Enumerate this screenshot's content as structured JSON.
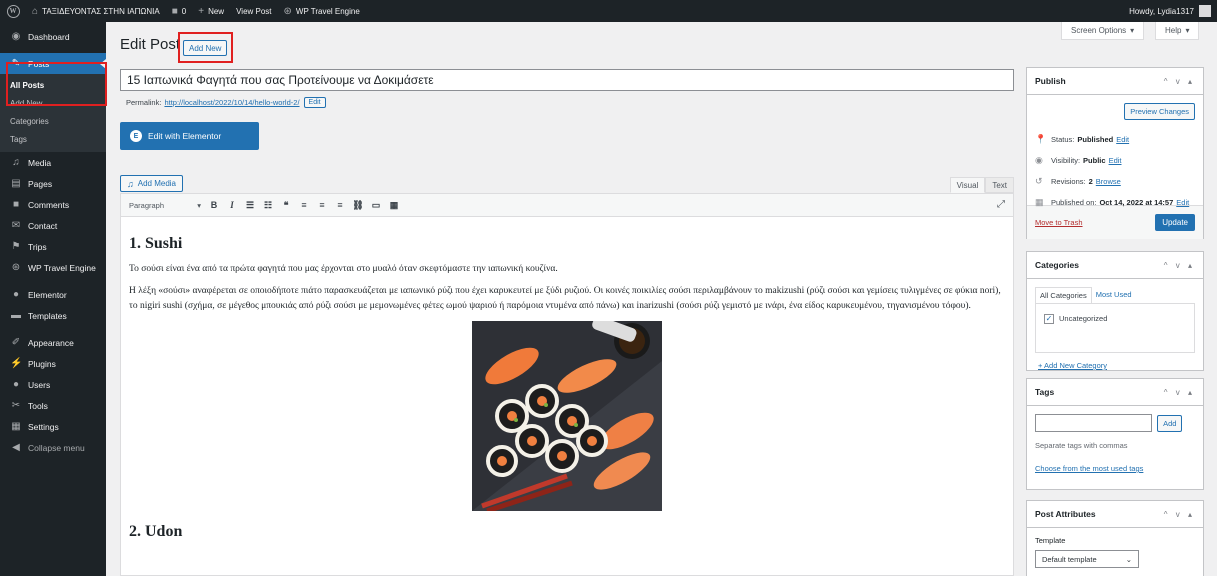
{
  "admin_bar": {
    "wp_logo": "W",
    "site_name": "ΤΑΞΙΔΕΥΟΝΤΑΣ ΣΤΗΝ ΙΑΠΩΝΙΑ",
    "comments_count": "0",
    "new_label": "New",
    "view_post_label": "View Post",
    "wp_travel_engine_label": "WP Travel Engine",
    "howdy": "Howdy, Lydia1317"
  },
  "sidebar": {
    "dashboard": "Dashboard",
    "posts": "Posts",
    "posts_submenu": [
      "All Posts",
      "Add New",
      "Categories",
      "Tags"
    ],
    "media": "Media",
    "pages": "Pages",
    "comments": "Comments",
    "contact": "Contact",
    "trips": "Trips",
    "wp_travel_engine": "WP Travel Engine",
    "elementor": "Elementor",
    "templates": "Templates",
    "appearance": "Appearance",
    "plugins": "Plugins",
    "users": "Users",
    "tools": "Tools",
    "settings": "Settings",
    "collapse": "Collapse menu"
  },
  "header": {
    "screen_options": "Screen Options",
    "help": "Help",
    "page_title": "Edit Post",
    "add_new": "Add New"
  },
  "post": {
    "title": "15 Ιαπωνικά Φαγητά που σας Προτείνουμε να Δοκιμάσετε",
    "permalink_label": "Permalink:",
    "permalink_url": "http://localhost/2022/10/14/hello-world-2/",
    "permalink_edit": "Edit",
    "elementor_button": "Edit with Elementor",
    "add_media": "Add Media",
    "tab_visual": "Visual",
    "tab_text": "Text",
    "format": "Paragraph"
  },
  "content": {
    "heading1": "1. Sushi",
    "para1": "Το σούσι είναι ένα από τα πρώτα φαγητά που μας έρχονται στο μυαλό όταν σκεφτόμαστε την ιαπωνική κουζίνα.",
    "para2": "Η λέξη «σούσι» αναφέρεται σε οποιοδήποτε πιάτο παρασκευάζεται με ιαπωνικό ρύζι που έχει καρυκευτεί με ξύδι ρυζιού. Οι κοινές ποικιλίες σούσι περιλαμβάνουν το makizushi (ρύζι σούσι και γεμίσεις τυλιγμένες σε φύκια nori), το nigiri sushi (σχήμα, σε μέγεθος μπουκιάς από ρύζι σούσι με μεμονωμένες φέτες ωμού ψαριού ή παρόμοια ντυμένα από πάνω) και inarizushi (σούσι ρύζι γεμιστό με ινάρι, ένα είδος καρυκευμένου, τηγανισμένου τόφου).",
    "heading2": "2. Udon"
  },
  "publish": {
    "title": "Publish",
    "preview": "Preview Changes",
    "status_label": "Status:",
    "status_value": "Published",
    "visibility_label": "Visibility:",
    "visibility_value": "Public",
    "revisions_label": "Revisions:",
    "revisions_value": "2",
    "browse": "Browse",
    "published_on_label": "Published on:",
    "published_on_value": "Oct 14, 2022 at 14:57",
    "edit": "Edit",
    "trash": "Move to Trash",
    "update": "Update"
  },
  "categories": {
    "title": "Categories",
    "tab_all": "All Categories",
    "tab_most": "Most Used",
    "item": "Uncategorized",
    "add_new": "+ Add New Category"
  },
  "tags": {
    "title": "Tags",
    "add": "Add",
    "hint": "Separate tags with commas",
    "choose": "Choose from the most used tags"
  },
  "attributes": {
    "title": "Post Attributes",
    "template_label": "Template",
    "template_value": "Default template"
  },
  "colors": {
    "admin_dark": "#1d2327",
    "accent": "#2271b1",
    "highlight": "#e02020"
  }
}
